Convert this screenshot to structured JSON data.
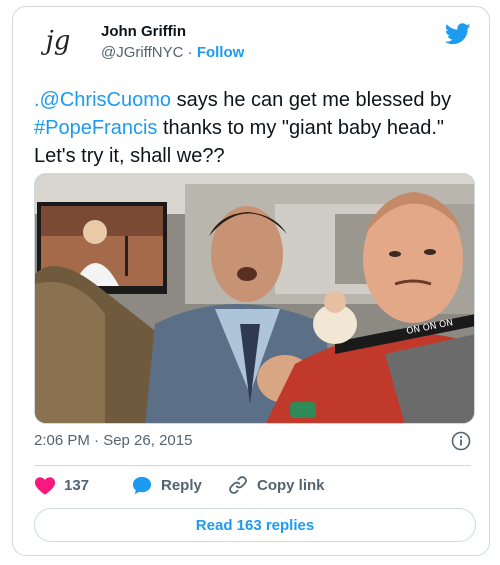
{
  "author": {
    "name": "John Griffin",
    "handle": "@JGriffNYC",
    "separator": "·",
    "follow_label": "Follow",
    "avatar_monogram": "jg"
  },
  "tweet": {
    "segments": [
      {
        "text": ".@ChrisCuomo",
        "kind": "link"
      },
      {
        "text": " says he can get me blessed by ",
        "kind": "plain"
      },
      {
        "text": "#PopeFrancis",
        "kind": "link"
      },
      {
        "text": " thanks to my \"giant baby head.\" Let's try it, shall we??",
        "kind": "plain"
      }
    ],
    "timestamp": "2:06 PM · Sep 26, 2015"
  },
  "photo": {
    "lanyard_text": "ON ON ON"
  },
  "actions": {
    "like_count": "137",
    "reply_label": "Reply",
    "copy_label": "Copy link"
  },
  "read_replies_label": "Read 163 replies",
  "colors": {
    "accent": "#1d9bf0",
    "heart": "#f91880",
    "muted": "#536471",
    "text": "#0f1419",
    "border": "#cfd9de"
  },
  "icons": [
    "twitter-bird-icon",
    "info-icon",
    "heart-icon",
    "reply-bubble-icon",
    "link-icon"
  ]
}
